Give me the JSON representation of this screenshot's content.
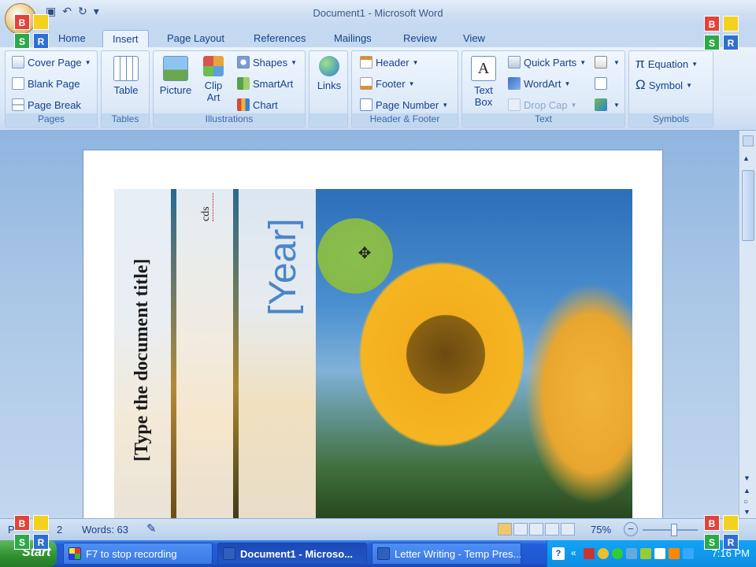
{
  "window": {
    "title": "Document1 - Microsoft Word"
  },
  "tabs": [
    "Home",
    "Insert",
    "Page Layout",
    "References",
    "Mailings",
    "Review",
    "View"
  ],
  "active_tab": "Insert",
  "ribbon": {
    "pages": {
      "label": "Pages",
      "cover_page": "Cover Page",
      "blank_page": "Blank Page",
      "page_break": "Page Break"
    },
    "tables": {
      "label": "Tables",
      "table": "Table"
    },
    "illustrations": {
      "label": "Illustrations",
      "picture": "Picture",
      "clip_art": "Clip Art",
      "shapes": "Shapes",
      "smartart": "SmartArt",
      "chart": "Chart"
    },
    "links": {
      "label": "",
      "links": "Links"
    },
    "header_footer": {
      "label": "Header & Footer",
      "header": "Header",
      "footer": "Footer",
      "page_number": "Page Number"
    },
    "text": {
      "label": "Text",
      "text_box": "Text Box",
      "quick_parts": "Quick Parts",
      "wordart": "WordArt",
      "drop_cap": "Drop Cap"
    },
    "symbols": {
      "label": "Symbols",
      "equation": "Equation",
      "symbol": "Symbol"
    }
  },
  "document": {
    "title_placeholder": "[Type the document title]",
    "year_placeholder": "[Year]",
    "company": "cds"
  },
  "status": {
    "page": "P",
    "page_count": "2",
    "words": "Words: 63",
    "zoom": "75%"
  },
  "taskbar": {
    "start": "Start",
    "tasks": [
      {
        "label": "F7 to stop recording",
        "active": false
      },
      {
        "label": "Document1 - Microso...",
        "active": true
      },
      {
        "label": "Letter Writing - Temp Pres...",
        "active": false
      }
    ],
    "clock": "7:16 PM"
  },
  "badges": {
    "b": "B",
    "s": "S",
    "r": "R"
  },
  "colors": {
    "accent": "#15428b",
    "ribbon": "#dbe8f7",
    "taskbar": "#245edb"
  }
}
